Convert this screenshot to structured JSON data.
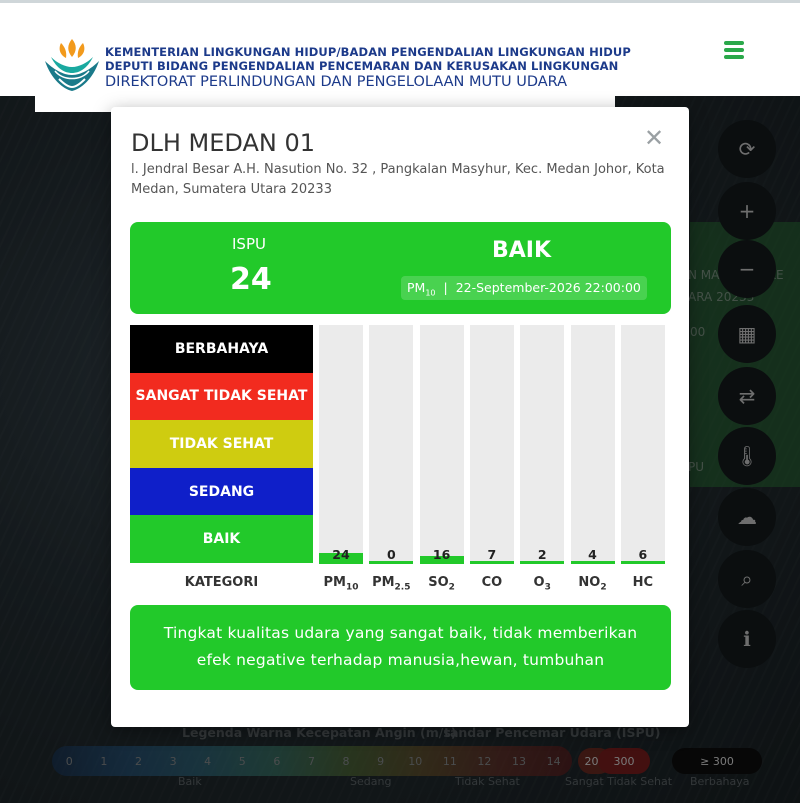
{
  "header": {
    "line1": "KEMENTERIAN LINGKUNGAN HIDUP/BADAN PENGENDALIAN LINGKUNGAN HIDUP",
    "line2": "DEPUTI BIDANG PENGENDALIAN PENCEMARAN DAN KERUSAKAN LINGKUNGAN",
    "line3": "DIREKTORAT PERLINDUNGAN DAN PENGELOLAAN MUTU UDARA"
  },
  "modal": {
    "station_name": "DLH MEDAN 01",
    "address": "l. Jendral Besar A.H. Nasution No. 32 , Pangkalan Masyhur, Kec. Medan Johor, Kota Medan, Sumatera Utara 20233",
    "ispu": {
      "label": "ISPU",
      "value": "24",
      "category": "BAIK",
      "pollutant_base": "PM",
      "pollutant_sub": "10",
      "separator": "|",
      "timestamp": "22-September-2026 22:00:00",
      "color": "#22c92a"
    },
    "categories_label": "KATEGORI",
    "categories": [
      {
        "name": "BERBAHAYA",
        "color": "#000000"
      },
      {
        "name": "SANGAT TIDAK SEHAT",
        "color": "#f22b1f"
      },
      {
        "name": "TIDAK SEHAT",
        "color": "#cfcc10"
      },
      {
        "name": "SEDANG",
        "color": "#0f1fc9"
      },
      {
        "name": "BAIK",
        "color": "#22c92a"
      }
    ],
    "description": "Tingkat kualitas udara yang sangat baik, tidak memberikan efek negative terhadap manusia,hewan, tumbuhan"
  },
  "chart_data": {
    "type": "bar",
    "categories": [
      "PM10",
      "PM2.5",
      "SO2",
      "CO",
      "O3",
      "NO2",
      "HC"
    ],
    "values": [
      24,
      0,
      16,
      7,
      2,
      4,
      6
    ],
    "ylim": [
      0,
      500
    ]
  },
  "pollutants": [
    {
      "base": "PM",
      "sub": "10"
    },
    {
      "base": "PM",
      "sub": "2.5"
    },
    {
      "base": "SO",
      "sub": "2"
    },
    {
      "base": "CO",
      "sub": ""
    },
    {
      "base": "O",
      "sub": "3"
    },
    {
      "base": "NO",
      "sub": "2"
    },
    {
      "base": "HC",
      "sub": ""
    }
  ],
  "side_controls": [
    {
      "icon": "refresh-icon",
      "glyph": "⟳"
    },
    {
      "icon": "zoom-in-icon",
      "glyph": "+"
    },
    {
      "icon": "zoom-out-icon",
      "glyph": "−"
    },
    {
      "icon": "map-icon",
      "glyph": "▦"
    },
    {
      "icon": "swap-icon",
      "glyph": "⇄"
    },
    {
      "icon": "thermometer-icon",
      "glyph": "🌡"
    },
    {
      "icon": "cloud-icon",
      "glyph": "☁"
    },
    {
      "icon": "search-icon",
      "glyph": "⌕"
    },
    {
      "icon": "info-icon",
      "glyph": "ℹ"
    }
  ],
  "legend": {
    "wind_title": "Legenda Warna Kecepatan Angin (m/s)",
    "ispu_title": "tandar Pencemar Udara (ISPU)",
    "wind_values": [
      "0",
      "1",
      "2",
      "3",
      "4",
      "5",
      "6",
      "7",
      "8",
      "9",
      "10",
      "11",
      "12",
      "13",
      "14"
    ],
    "ispu_values": [
      "200",
      "300",
      "≥ 300"
    ],
    "labels": [
      "Baik",
      "Sedang",
      "Tidak Sehat",
      "Sangat Tidak Sehat",
      "Berbahaya"
    ]
  }
}
